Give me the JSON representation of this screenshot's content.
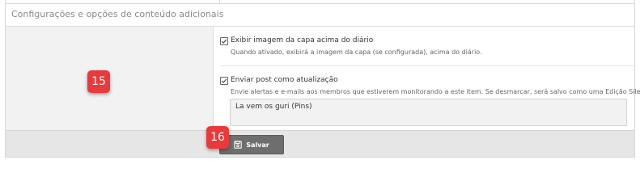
{
  "panel": {
    "title": "Configurações e opções de conteúdo adicionais"
  },
  "options": [
    {
      "label": "Exibir imagem da capa acima do diário",
      "hint": "Quando ativado, exibirá a imagem da capa (se configurada), acima do diário.",
      "checked": true
    },
    {
      "label": "Enviar post como atualização",
      "hint": "Envie alertas e e-mails aos membros que estiverem monitorando a este item. Se desmarcar, será salvo como uma Edição Silenciosa.",
      "checked": true
    }
  ],
  "status_text": {
    "value": "La vem os guri (Pins)"
  },
  "footer": {
    "save_label": "Salvar"
  },
  "annotations": {
    "badge_a": "15",
    "badge_b": "16"
  },
  "icons": {
    "checkbox": "checkmark-icon",
    "save": "floppy-disk-icon"
  },
  "colors": {
    "badge": "#e83a3a",
    "save_button": "#6e6e6e",
    "footer_bg": "#e6e6e6",
    "left_column_bg": "#f2f2f2"
  }
}
